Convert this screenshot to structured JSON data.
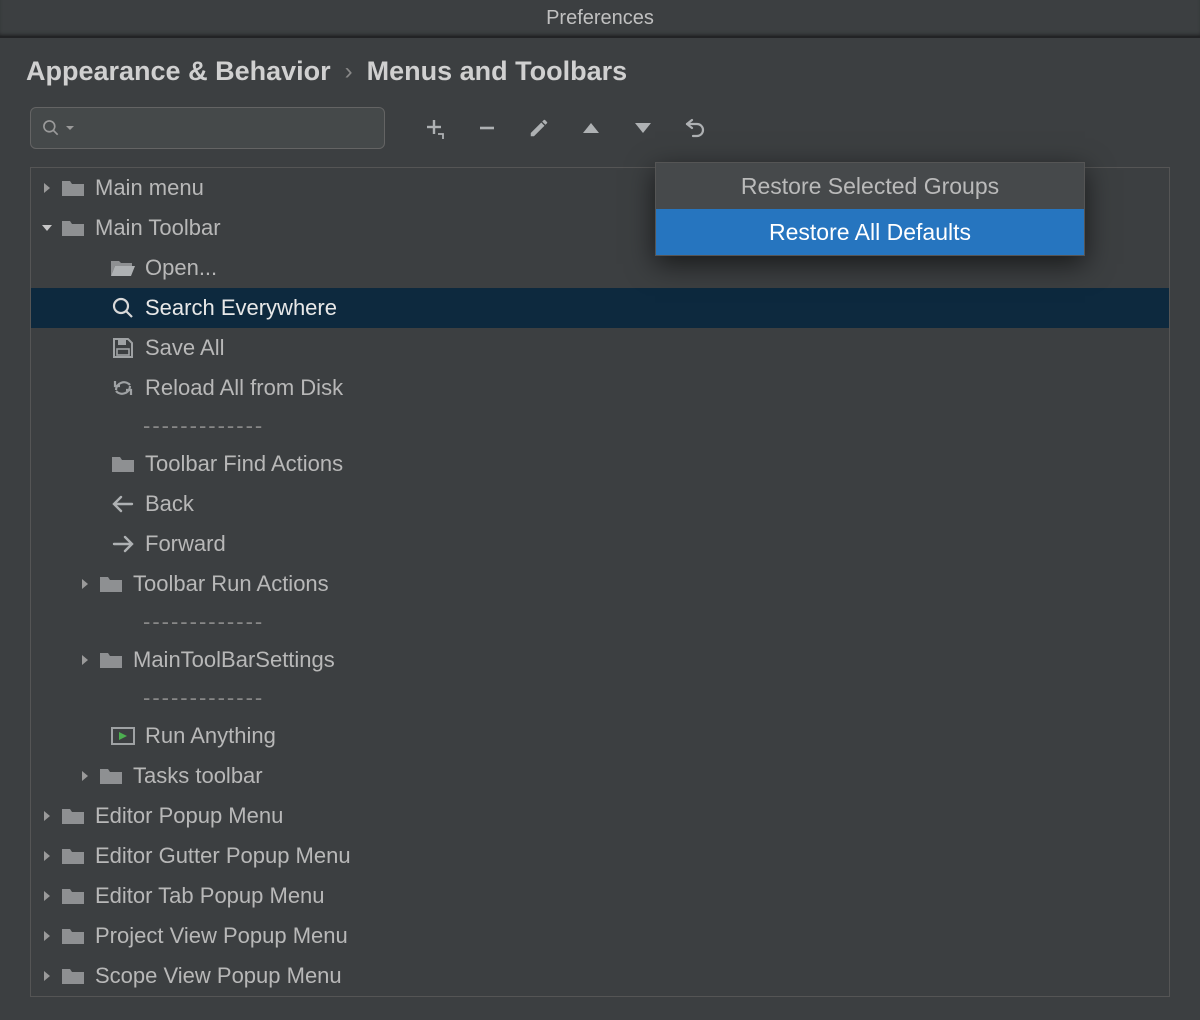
{
  "window": {
    "title": "Preferences"
  },
  "breadcrumb": {
    "category": "Appearance & Behavior",
    "page": "Menus and Toolbars"
  },
  "search": {
    "placeholder": ""
  },
  "separator_text": "-------------",
  "tree": {
    "root": [
      {
        "label": "Main menu",
        "expanded": false
      },
      {
        "label": "Main Toolbar",
        "expanded": true,
        "children": [
          {
            "label": "Open...",
            "icon": "open-folder"
          },
          {
            "label": "Search Everywhere",
            "icon": "search",
            "selected": true
          },
          {
            "label": "Save All",
            "icon": "save"
          },
          {
            "label": "Reload All from Disk",
            "icon": "reload"
          },
          {
            "separator": true
          },
          {
            "label": "Toolbar Find Actions",
            "icon": "folder",
            "expandable": false
          },
          {
            "label": "Back",
            "icon": "arrow-left"
          },
          {
            "label": "Forward",
            "icon": "arrow-right"
          },
          {
            "label": "Toolbar Run Actions",
            "icon": "folder",
            "expandable": true
          },
          {
            "separator": true
          },
          {
            "label": "MainToolBarSettings",
            "icon": "folder",
            "expandable": true
          },
          {
            "separator": true
          },
          {
            "label": "Run Anything",
            "icon": "run-anything"
          },
          {
            "label": "Tasks toolbar",
            "icon": "folder",
            "expandable": true
          }
        ]
      },
      {
        "label": "Editor Popup Menu",
        "expanded": false
      },
      {
        "label": "Editor Gutter Popup Menu",
        "expanded": false
      },
      {
        "label": "Editor Tab Popup Menu",
        "expanded": false
      },
      {
        "label": "Project View Popup Menu",
        "expanded": false
      },
      {
        "label": "Scope View Popup Menu",
        "expanded": false
      }
    ]
  },
  "popup": {
    "items": [
      {
        "label": "Restore Selected Groups",
        "highlight": false
      },
      {
        "label": "Restore All Defaults",
        "highlight": true
      }
    ]
  }
}
